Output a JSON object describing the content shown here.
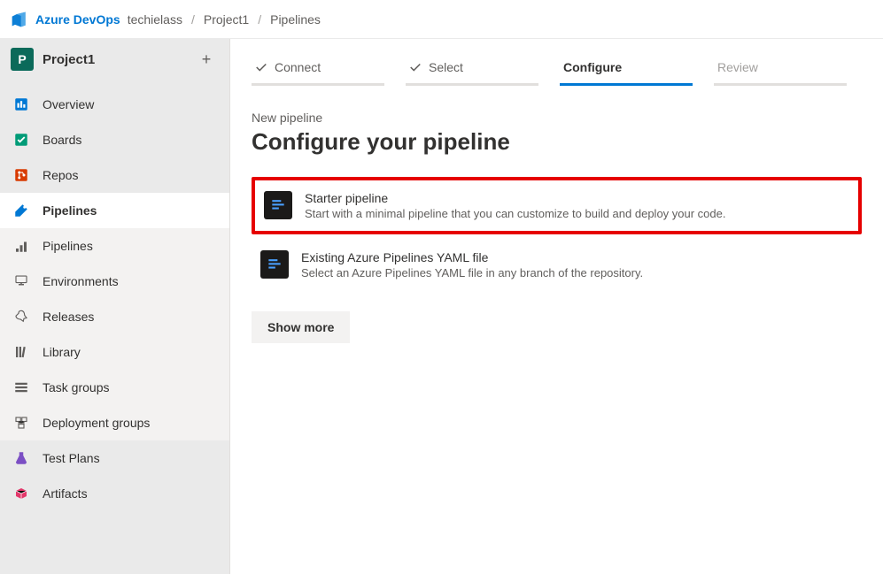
{
  "header": {
    "brand": "Azure DevOps",
    "crumb_org": "techielass",
    "crumb_project": "Project1",
    "crumb_section": "Pipelines"
  },
  "project": {
    "badge_letter": "P",
    "name": "Project1"
  },
  "nav": {
    "overview": "Overview",
    "boards": "Boards",
    "repos": "Repos",
    "pipelines": "Pipelines",
    "sub_pipelines": "Pipelines",
    "sub_environments": "Environments",
    "sub_releases": "Releases",
    "sub_library": "Library",
    "sub_taskgroups": "Task groups",
    "sub_deploygroups": "Deployment groups",
    "testplans": "Test Plans",
    "artifacts": "Artifacts"
  },
  "wizard": {
    "step_connect": "Connect",
    "step_select": "Select",
    "step_configure": "Configure",
    "step_review": "Review"
  },
  "page": {
    "subhead": "New pipeline",
    "title": "Configure your pipeline"
  },
  "options": {
    "starter_title": "Starter pipeline",
    "starter_desc": "Start with a minimal pipeline that you can customize to build and deploy your code.",
    "yaml_title": "Existing Azure Pipelines YAML file",
    "yaml_desc": "Select an Azure Pipelines YAML file in any branch of the repository."
  },
  "buttons": {
    "show_more": "Show more"
  }
}
